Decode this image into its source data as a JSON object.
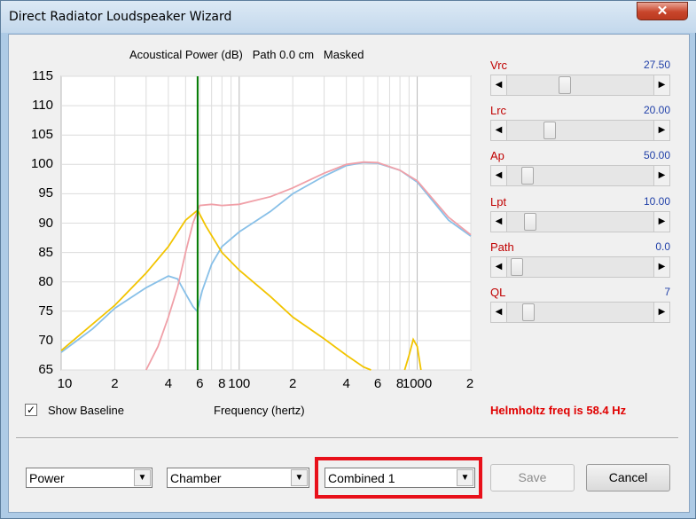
{
  "window": {
    "title": "Direct Radiator Loudspeaker Wizard",
    "close_glyph": "✕"
  },
  "chart": {
    "title": "Acoustical Power (dB)   Path 0.0 cm   Masked",
    "x_axis_label": "Frequency (hertz)"
  },
  "chart_data": {
    "type": "line",
    "title": "Acoustical Power (dB)   Path 0.0 cm   Masked",
    "xlabel": "Frequency (hertz)",
    "ylabel": "",
    "x_scale": "log",
    "xlim": [
      10,
      2000
    ],
    "ylim": [
      65,
      115
    ],
    "y_ticks": [
      115,
      110,
      105,
      100,
      95,
      90,
      85,
      80,
      75,
      70,
      65
    ],
    "x_ticks": [
      {
        "value": 10,
        "label": "10"
      },
      {
        "value": 20,
        "label": "2"
      },
      {
        "value": 40,
        "label": "4"
      },
      {
        "value": 60,
        "label": "6"
      },
      {
        "value": 80,
        "label": "8"
      },
      {
        "value": 100,
        "label": "100"
      },
      {
        "value": 200,
        "label": "2"
      },
      {
        "value": 400,
        "label": "4"
      },
      {
        "value": 600,
        "label": "6"
      },
      {
        "value": 800,
        "label": "8"
      },
      {
        "value": 1000,
        "label": "1000"
      },
      {
        "value": 2000,
        "label": "2"
      }
    ],
    "grid": true,
    "marker_line": {
      "x": 58.4,
      "color": "#007a00"
    },
    "series": [
      {
        "color": "#88c0e8",
        "points": [
          [
            10,
            68
          ],
          [
            15,
            72
          ],
          [
            20,
            75.5
          ],
          [
            30,
            79
          ],
          [
            40,
            81
          ],
          [
            45,
            80.5
          ],
          [
            50,
            78
          ],
          [
            55,
            75.8
          ],
          [
            58,
            75
          ],
          [
            62,
            78.5
          ],
          [
            70,
            83
          ],
          [
            80,
            86
          ],
          [
            100,
            88.5
          ],
          [
            150,
            92
          ],
          [
            200,
            95
          ],
          [
            300,
            98
          ],
          [
            400,
            99.8
          ],
          [
            500,
            100.3
          ],
          [
            600,
            100.2
          ],
          [
            800,
            99
          ],
          [
            1000,
            97
          ],
          [
            1500,
            90.5
          ],
          [
            2000,
            87.8
          ]
        ]
      },
      {
        "color": "#f0a0a8",
        "points": [
          [
            30,
            65
          ],
          [
            35,
            69
          ],
          [
            40,
            74
          ],
          [
            45,
            79
          ],
          [
            50,
            85
          ],
          [
            55,
            90
          ],
          [
            60,
            93
          ],
          [
            70,
            93.2
          ],
          [
            80,
            93
          ],
          [
            100,
            93.2
          ],
          [
            150,
            94.5
          ],
          [
            200,
            96
          ],
          [
            300,
            98.5
          ],
          [
            400,
            100
          ],
          [
            500,
            100.4
          ],
          [
            600,
            100.3
          ],
          [
            800,
            99
          ],
          [
            1000,
            97.2
          ],
          [
            1500,
            91
          ],
          [
            2000,
            88
          ]
        ]
      },
      {
        "color": "#f2c400",
        "points": [
          [
            10,
            68.3
          ],
          [
            20,
            76
          ],
          [
            30,
            81.5
          ],
          [
            40,
            86
          ],
          [
            50,
            90.5
          ],
          [
            58.4,
            92.2
          ],
          [
            65,
            89.5
          ],
          [
            80,
            85
          ],
          [
            100,
            82
          ],
          [
            150,
            77.5
          ],
          [
            200,
            74
          ],
          [
            300,
            70.3
          ],
          [
            400,
            67.5
          ],
          [
            500,
            65.5
          ],
          [
            550,
            64.8
          ]
        ]
      },
      {
        "color": "#f2c400",
        "points": [
          [
            850,
            64.8
          ],
          [
            900,
            67.5
          ],
          [
            950,
            70.2
          ],
          [
            1000,
            69
          ],
          [
            1050,
            65
          ]
        ]
      }
    ]
  },
  "sliders": [
    {
      "label": "Vrc",
      "value": "27.50",
      "position": 0.38
    },
    {
      "label": "Lrc",
      "value": "20.00",
      "position": 0.27
    },
    {
      "label": "Ap",
      "value": "50.00",
      "position": 0.1
    },
    {
      "label": "Lpt",
      "value": "10.00",
      "position": 0.12
    },
    {
      "label": "Path",
      "value": "0.0",
      "position": 0.02
    },
    {
      "label": "QL",
      "value": "7",
      "position": 0.11
    }
  ],
  "show_baseline": {
    "label": "Show Baseline",
    "checked": true,
    "check_glyph": "✓"
  },
  "helmholtz_text": "Helmholtz freq is 58.4 Hz",
  "dropdowns": {
    "display": "Power",
    "enclosure": "Chamber",
    "config": "Combined 1",
    "arrow_glyph": "▼"
  },
  "buttons": {
    "save": "Save",
    "cancel": "Cancel"
  },
  "glyphs": {
    "left_arrow": "◀",
    "right_arrow": "▶"
  }
}
